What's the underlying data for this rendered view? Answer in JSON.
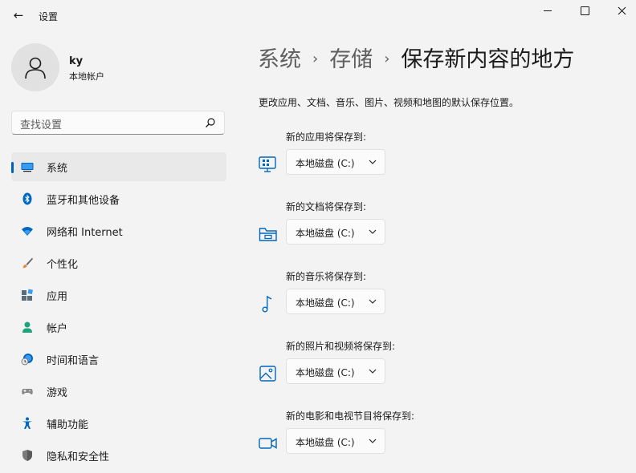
{
  "window": {
    "title": "设置",
    "back_glyph": "←",
    "controls": [
      "minimize-icon",
      "maximize-icon",
      "close-icon"
    ]
  },
  "user": {
    "name": "ky",
    "account_type": "本地帐户"
  },
  "search": {
    "placeholder": "查找设置"
  },
  "sidebar": {
    "items": [
      {
        "label": "系统",
        "icon": "system-icon",
        "active": true
      },
      {
        "label": "蓝牙和其他设备",
        "icon": "bluetooth-icon"
      },
      {
        "label": "网络和 Internet",
        "icon": "wifi-icon"
      },
      {
        "label": "个性化",
        "icon": "brush-icon"
      },
      {
        "label": "应用",
        "icon": "apps-icon"
      },
      {
        "label": "帐户",
        "icon": "account-icon"
      },
      {
        "label": "时间和语言",
        "icon": "time-language-icon"
      },
      {
        "label": "游戏",
        "icon": "gamepad-icon"
      },
      {
        "label": "辅助功能",
        "icon": "accessibility-icon"
      },
      {
        "label": "隐私和安全性",
        "icon": "shield-icon"
      }
    ]
  },
  "breadcrumb": {
    "parts": [
      "系统",
      "存储"
    ],
    "separator": "›",
    "current": "保存新内容的地方"
  },
  "description": "更改应用、文档、音乐、图片、视频和地图的默认保存位置。",
  "settings": [
    {
      "label": "新的应用将保存到:",
      "icon": "apps-save-icon",
      "value": "本地磁盘 (C:)"
    },
    {
      "label": "新的文档将保存到:",
      "icon": "folder-icon",
      "value": "本地磁盘 (C:)"
    },
    {
      "label": "新的音乐将保存到:",
      "icon": "music-note-icon",
      "value": "本地磁盘 (C:)"
    },
    {
      "label": "新的照片和视频将保存到:",
      "icon": "photo-icon",
      "value": "本地磁盘 (C:)"
    },
    {
      "label": "新的电影和电视节目将保存到:",
      "icon": "video-camera-icon",
      "value": "本地磁盘 (C:)"
    }
  ],
  "colors": {
    "accent": "#005fb8",
    "background": "#f3f3f3",
    "icon_blue": "#0067c0"
  }
}
